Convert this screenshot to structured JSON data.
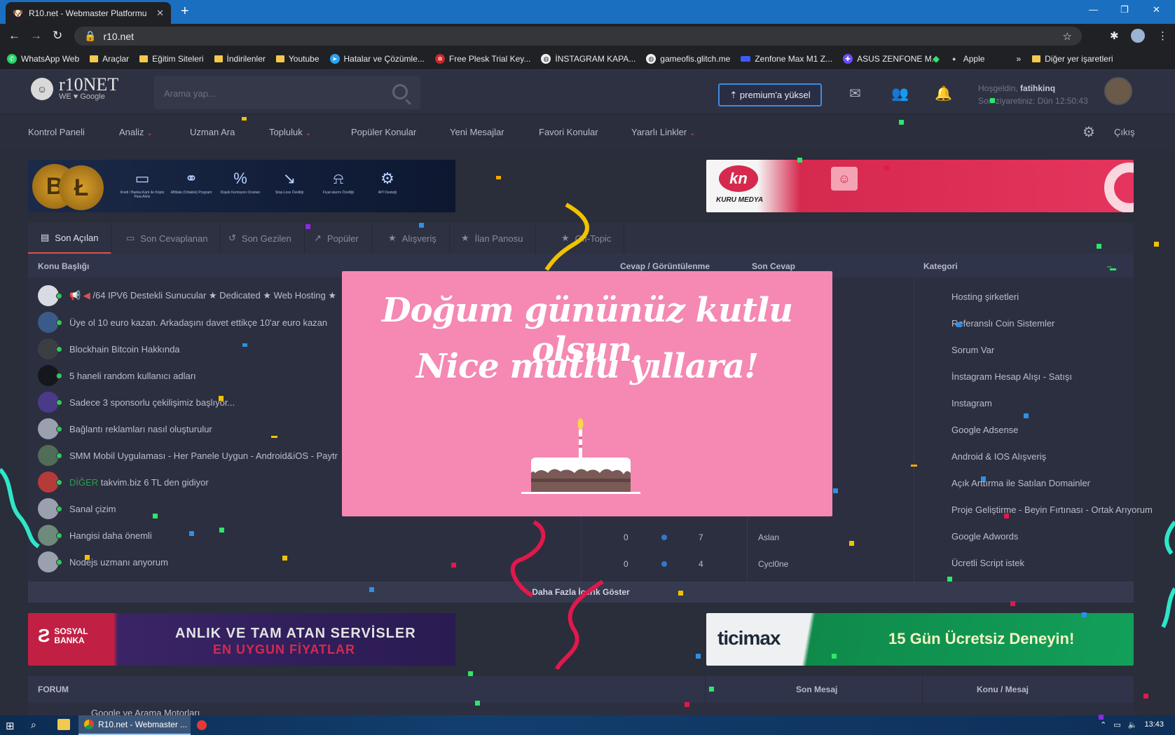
{
  "browser": {
    "tab_title": "R10.net - Webmaster Platformu",
    "url": "r10.net",
    "bookmarks": [
      "WhatsApp Web",
      "Araçlar",
      "Eğitim Siteleri",
      "İndirilenler",
      "Youtube",
      "Hatalar ve Çözümle...",
      "Free Plesk Trial Key...",
      "İNSTAGRAM KAPA...",
      "gameofis.glitch.me",
      "Zenfone Max M1 Z...",
      "ASUS ZENFONE M...",
      "Apple"
    ],
    "bookmarks_more": "»",
    "other_bookmarks": "Diğer yer işaretleri"
  },
  "header": {
    "logo_main": "r10NET",
    "logo_sub": "WE ♥ Google",
    "search_placeholder": "Arama yap...",
    "premium_label": "⇡ premium'a yüksel",
    "welcome_prefix": "Hoşgeldin, ",
    "username": "fatihkinq",
    "last_visit": "Son ziyaretiniz: Dün 12:50:43"
  },
  "nav": {
    "items": [
      "Kontrol Paneli",
      "Analiz",
      "Uzman Ara",
      "Topluluk",
      "Popüler Konular",
      "Yeni Mesajlar",
      "Favori Konular",
      "Yararlı Linkler"
    ],
    "logout": "Çıkış"
  },
  "crypto_banner": {
    "coins": [
      "B",
      "Ł"
    ],
    "items": [
      "Kredi / Banka Kartı ile Kripto Para Alımı",
      "Affiliate (Ortaklık) Program",
      "Düşük Komisyon Oranları",
      "Stop-Loss Özelliği",
      "Fiyat alarmı Özelliği",
      "API Desteği"
    ]
  },
  "kuru_banner": {
    "logo": "kn",
    "name": "KURU MEDYA"
  },
  "content_tabs": [
    "Son Açılan",
    "Son Cevaplanan",
    "Son Gezilen",
    "Popüler",
    "Alışveriş",
    "İlan Panosu",
    "Off-Topic"
  ],
  "table_headers": {
    "topic": "Konu Başlığı",
    "replies_views": "Cevap / Görüntülenme",
    "last_reply": "Son Cevap",
    "category": "Kategori"
  },
  "topics": [
    {
      "prefix": "📢 ◀ ",
      "title": "/64 IPV6 Destekli Sunucular ★ Dedicated ★ Web Hosting ★"
    },
    {
      "prefix": "",
      "title": "Üye ol 10 euro kazan. Arkadaşını davet ettikçe 10'ar euro kazan"
    },
    {
      "prefix": "",
      "title": "Blockhain Bitcoin Hakkında"
    },
    {
      "prefix": "",
      "title": "5 haneli random kullanıcı adları"
    },
    {
      "prefix": "",
      "title": "Sadece 3 sponsorlu çekilişimiz başlıyor..."
    },
    {
      "prefix": "",
      "title": "Bağlantı reklamları nasıl oluşturulur"
    },
    {
      "prefix": "",
      "title": "SMM Mobil Uygulaması - Her Panele Uygun - Android&iOS - Paytr"
    },
    {
      "prefix": "DİĞER ",
      "title": "takvim.biz 6 TL den gidiyor"
    },
    {
      "prefix": "",
      "title": "Sanal çizim"
    },
    {
      "prefix": "",
      "title": "Hangisi daha önemli"
    },
    {
      "prefix": "",
      "title": "Nodejs uzmanı anyorum"
    }
  ],
  "stats": [
    {
      "replies": "0",
      "views": "7",
      "last": "Aslan"
    },
    {
      "replies": "0",
      "views": "4",
      "last": "Cycl0ne"
    }
  ],
  "categories": [
    "Hosting şirketleri",
    "Referanslı Coin Sistemler",
    "Sorum Var",
    "İnstagram Hesap Alışı - Satışı",
    "Instagram",
    "Google Adsense",
    "Android & IOS Alışveriş",
    "Açık Arttırma ile Satılan Domainler",
    "Proje Geliştirme - Beyin Fırtınası - Ortak Arıyorum",
    "Google Adwords",
    "Ücretli Script istek"
  ],
  "more_button": "Daha Fazla İçerik Göster",
  "sosyal_banner": {
    "logo": "SOSYAL BANKA",
    "line1": "ANLIK VE TAM ATAN SERVİSLER",
    "line2": "EN UYGUN FİYATLAR"
  },
  "ticimax_banner": {
    "logo": "ticimax",
    "slogan": "15 Gün Ücretsiz Deneyin!"
  },
  "forum_headers": {
    "forum": "FORUM",
    "last_msg": "Son Mesaj",
    "topic_msg": "Konu / Mesaj"
  },
  "forum_peek": "Google ve Arama Motorları",
  "birthday": {
    "line1": "Doğum gününüz kutlu olsun.",
    "line2": "Nice mutlu yıllara!"
  },
  "taskbar": {
    "app_label": "R10.net - Webmaster ...",
    "time": "13:43"
  },
  "colors": {
    "accent": "#d9534f",
    "popup_bg": "#f589b3",
    "link_blue": "#3f8ae0"
  }
}
